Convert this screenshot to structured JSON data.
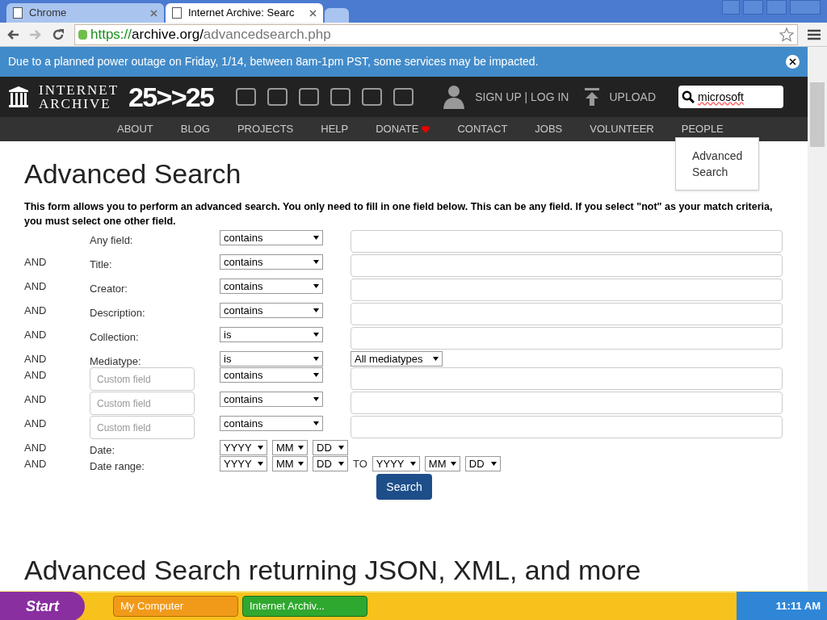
{
  "tabs": [
    {
      "label": "Chrome",
      "selected": false
    },
    {
      "label": "Internet Archive: Searc",
      "selected": true
    }
  ],
  "address": {
    "scheme": "https://",
    "host": "archive.org/",
    "path": "advancedsearch.php"
  },
  "banner": {
    "text": "Due to a planned power outage on Friday, 1/14, between 8am-1pm PST, some services may be impacted."
  },
  "header": {
    "logo_line1": "INTERNET",
    "logo_line2": "ARCHIVE",
    "anniversary": "25>>25",
    "account": "SIGN UP | LOG IN",
    "upload": "UPLOAD",
    "search_value": "microsoft"
  },
  "nav": [
    "ABOUT",
    "BLOG",
    "PROJECTS",
    "HELP",
    "DONATE",
    "CONTACT",
    "JOBS",
    "VOLUNTEER",
    "PEOPLE"
  ],
  "search_menu": [
    "Advanced Search"
  ],
  "page": {
    "title": "Advanced Search",
    "intro": "This form allows you to perform an advanced search. You only need to fill in one field below. This can be any field. If you select \"not\" as your match criteria, you must select one other field.",
    "rows": [
      {
        "kind": "text",
        "connector": "",
        "label": "Any field:",
        "operator": "contains"
      },
      {
        "kind": "text",
        "connector": "AND",
        "label": "Title:",
        "operator": "contains"
      },
      {
        "kind": "text",
        "connector": "AND",
        "label": "Creator:",
        "operator": "contains"
      },
      {
        "kind": "text",
        "connector": "AND",
        "label": "Description:",
        "operator": "contains"
      },
      {
        "kind": "text",
        "connector": "AND",
        "label": "Collection:",
        "operator": "is"
      },
      {
        "kind": "mediatype",
        "connector": "AND",
        "label": "Mediatype:",
        "operator": "is",
        "value": "All mediatypes"
      },
      {
        "kind": "custom",
        "connector": "AND",
        "placeholder": "Custom field",
        "operator": "contains"
      },
      {
        "kind": "custom",
        "connector": "AND",
        "placeholder": "Custom field",
        "operator": "contains"
      },
      {
        "kind": "custom",
        "connector": "AND",
        "placeholder": "Custom field",
        "operator": "contains"
      },
      {
        "kind": "date",
        "connector": "AND",
        "label": "Date:",
        "parts": [
          "YYYY",
          "MM",
          "DD"
        ]
      },
      {
        "kind": "daterange",
        "connector": "AND",
        "label": "Date range:",
        "parts": [
          "YYYY",
          "MM",
          "DD"
        ],
        "to": "TO",
        "parts2": [
          "YYYY",
          "MM",
          "DD"
        ]
      }
    ],
    "button": "Search",
    "subtitle": "Advanced Search returning JSON, XML, and more"
  },
  "taskbar": {
    "start": "Start",
    "items": [
      {
        "label": "My Computer",
        "selected": false
      },
      {
        "label": "Internet Archiv...",
        "selected": true
      }
    ],
    "clock": "11:11 AM"
  }
}
